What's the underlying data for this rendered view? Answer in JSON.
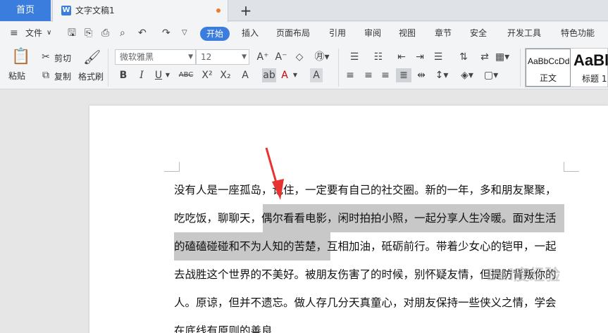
{
  "tabs": {
    "home": "首页",
    "doc_icon": "W",
    "doc_title": "文字文稿1",
    "add": "+"
  },
  "menu": {
    "hamburger": "≡",
    "file": "文件",
    "file_caret": "∨",
    "items": [
      "开始",
      "插入",
      "页面布局",
      "引用",
      "审阅",
      "视图",
      "章节",
      "安全",
      "开发工具",
      "特色功能"
    ]
  },
  "ribbon": {
    "paste": "粘贴",
    "cut": "剪切",
    "copy": "复制",
    "format_painter": "格式刷",
    "font_name": "微软雅黑",
    "font_size": "12",
    "bold": "B",
    "italic": "I",
    "underline": "U",
    "strike": "ABC",
    "superscript": "X²",
    "subscript": "X₂",
    "grow": "A⁺",
    "shrink": "A⁻",
    "styles": [
      {
        "sample": "AaBbCcDd",
        "name": "正文"
      },
      {
        "sample": "AaBl",
        "name": "标题 1"
      }
    ]
  },
  "document": {
    "lines": [
      "没有人是一座孤岛，记住，一定要有自己的社交圈。新的一年，多和朋友聚聚，",
      "吃吃饭，聊聊天，偶尔看看电影，闲时拍拍小照，一起分享人生冷暖。面对生活",
      "的磕磕碰碰和不为人知的苦楚，互相加油，砥砺前行。带着少女心的铠甲，一起",
      "去战胜这个世界的不美好。被朋友伤害了的时候，别怀疑友情，但提防背叛你的",
      "人。原谅，但并不遗忘。做人存几分天真童心，对朋友保持一些侠义之情，学会",
      "在底线有原则的善良"
    ]
  },
  "watermark": "Bai度经验",
  "colors": {
    "accent": "#3b7ddd",
    "selection": "#c8c8c8",
    "arrow": "#e8322f"
  }
}
